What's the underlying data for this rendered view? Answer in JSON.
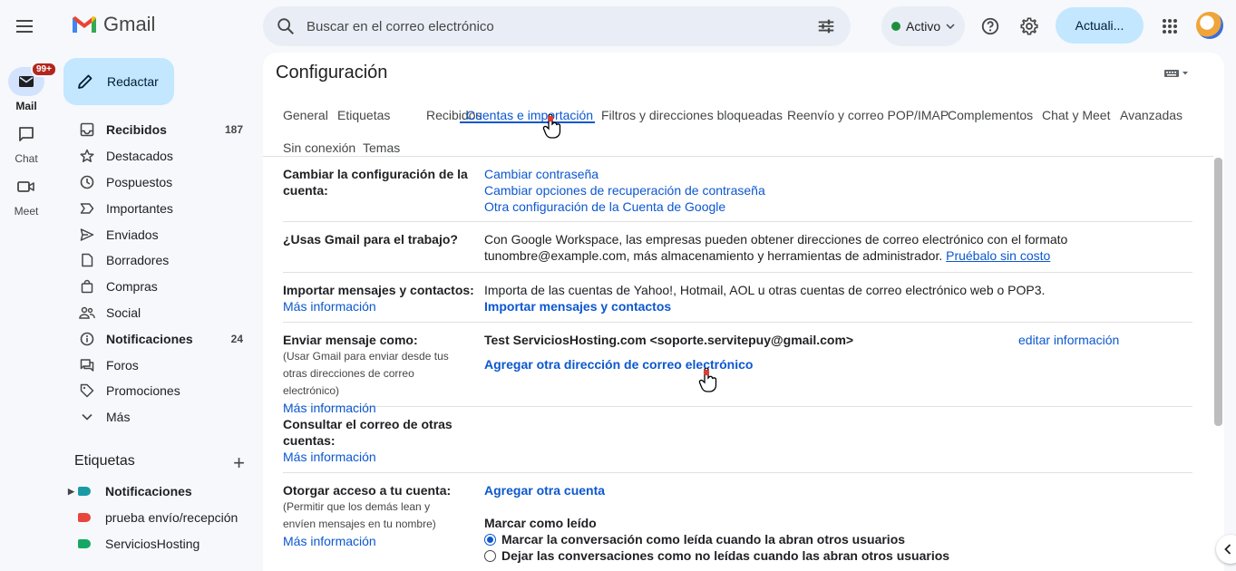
{
  "app": {
    "name": "Gmail"
  },
  "search": {
    "placeholder": "Buscar en el correo electrónico"
  },
  "status": {
    "label": "Activo",
    "color": "#1e8e3e"
  },
  "header": {
    "update_button": "Actuali..."
  },
  "rail": [
    {
      "label": "Mail",
      "badge": "99+"
    },
    {
      "label": "Chat"
    },
    {
      "label": "Meet"
    }
  ],
  "compose": {
    "label": "Redactar"
  },
  "nav": [
    {
      "label": "Recibidos",
      "count": "187",
      "icon": "inbox-icon",
      "bold": true
    },
    {
      "label": "Destacados",
      "count": "",
      "icon": "star-icon"
    },
    {
      "label": "Pospuestos",
      "count": "",
      "icon": "clock-icon"
    },
    {
      "label": "Importantes",
      "count": "",
      "icon": "label-important-icon"
    },
    {
      "label": "Enviados",
      "count": "",
      "icon": "send-icon"
    },
    {
      "label": "Borradores",
      "count": "",
      "icon": "draft-icon"
    },
    {
      "label": "Compras",
      "count": "",
      "icon": "shopping-bag-icon"
    },
    {
      "label": "Social",
      "count": "",
      "icon": "people-icon"
    },
    {
      "label": "Notificaciones",
      "count": "24",
      "icon": "info-icon",
      "bold": true
    },
    {
      "label": "Foros",
      "count": "",
      "icon": "forum-icon"
    },
    {
      "label": "Promociones",
      "count": "",
      "icon": "tag-icon"
    },
    {
      "label": "Más",
      "count": "",
      "icon": "chevron-down-icon"
    }
  ],
  "labels": {
    "title": "Etiquetas",
    "items": [
      {
        "label": "Notificaciones",
        "color": "#1a9aa6",
        "bold": true
      },
      {
        "label": "prueba envío/recepción",
        "color": "#e8453c"
      },
      {
        "label": "ServiciosHosting",
        "color": "#16a765"
      }
    ]
  },
  "settings": {
    "title": "Configuración",
    "tabs": [
      "General",
      "Etiquetas",
      "Recibidos",
      "Cuentas e importación",
      "Filtros y direcciones bloqueadas",
      "Reenvío y correo POP/IMAP",
      "Complementos",
      "Chat y Meet",
      "Avanzadas",
      "Sin conexión",
      "Temas"
    ],
    "active_tab": "Cuentas e importación",
    "sections": {
      "change_account": {
        "label": "Cambiar la configuración de la cuenta:",
        "links": [
          "Cambiar contraseña",
          "Cambiar opciones de recuperación de contraseña",
          "Otra configuración de la Cuenta de Google"
        ]
      },
      "work": {
        "label": "¿Usas Gmail para el trabajo?",
        "text": "Con Google Workspace, las empresas pueden obtener direcciones de correo electrónico con el formato tunombre@example.com, más almacenamiento y herramientas de administrador.",
        "link": "Pruébalo sin costo"
      },
      "import": {
        "label": "Importar mensajes y contactos:",
        "more": "Más información",
        "text": "Importa de las cuentas de Yahoo!, Hotmail, AOL u otras cuentas de correo electrónico web o POP3.",
        "action": "Importar mensajes y contactos"
      },
      "send_as": {
        "label": "Enviar mensaje como:",
        "sub": "(Usar Gmail para enviar desde tus otras direcciones de correo electrónico)",
        "more": "Más información",
        "address": "Test ServiciosHosting.com <soporte.servitepuy@gmail.com>",
        "edit": "editar información",
        "action": "Agregar otra dirección de correo electrónico"
      },
      "check_mail": {
        "label": "Consultar el correo de otras cuentas:",
        "more": "Más información"
      },
      "grant": {
        "label": "Otorgar acceso a tu cuenta:",
        "sub": "(Permitir que los demás lean y envíen mensajes en tu nombre)",
        "more": "Más información",
        "action": "Agregar otra cuenta",
        "mark_title": "Marcar como leído",
        "option_1": "Marcar la conversación como leída cuando la abran otros usuarios",
        "option_2": "Dejar las conversaciones como no leídas cuando las abran otros usuarios",
        "selected": 1
      }
    }
  }
}
